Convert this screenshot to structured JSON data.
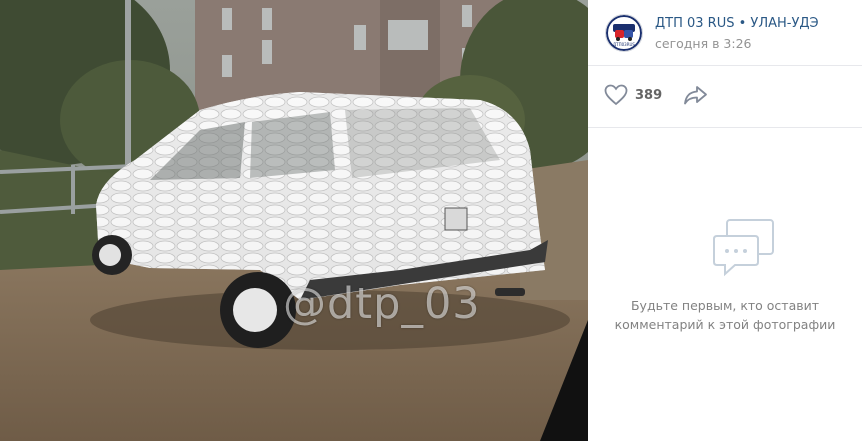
{
  "photo": {
    "watermark": "@dtp_03"
  },
  "post": {
    "author": "ДТП 03 RUS • УЛАН-УДЭ",
    "time": "сегодня в 3:26",
    "avatar_text": "ДТП03RUS",
    "likes": "389"
  },
  "comments": {
    "empty_line1": "Будьте первым, кто оставит",
    "empty_line2": "комментарий к этой фотографии"
  },
  "icons": {
    "like": "heart-outline-icon",
    "share": "share-arrow-icon",
    "empty": "comment-bubble-icon"
  },
  "colors": {
    "link": "#2a5885",
    "muted": "#939393",
    "icon": "#828a99"
  }
}
